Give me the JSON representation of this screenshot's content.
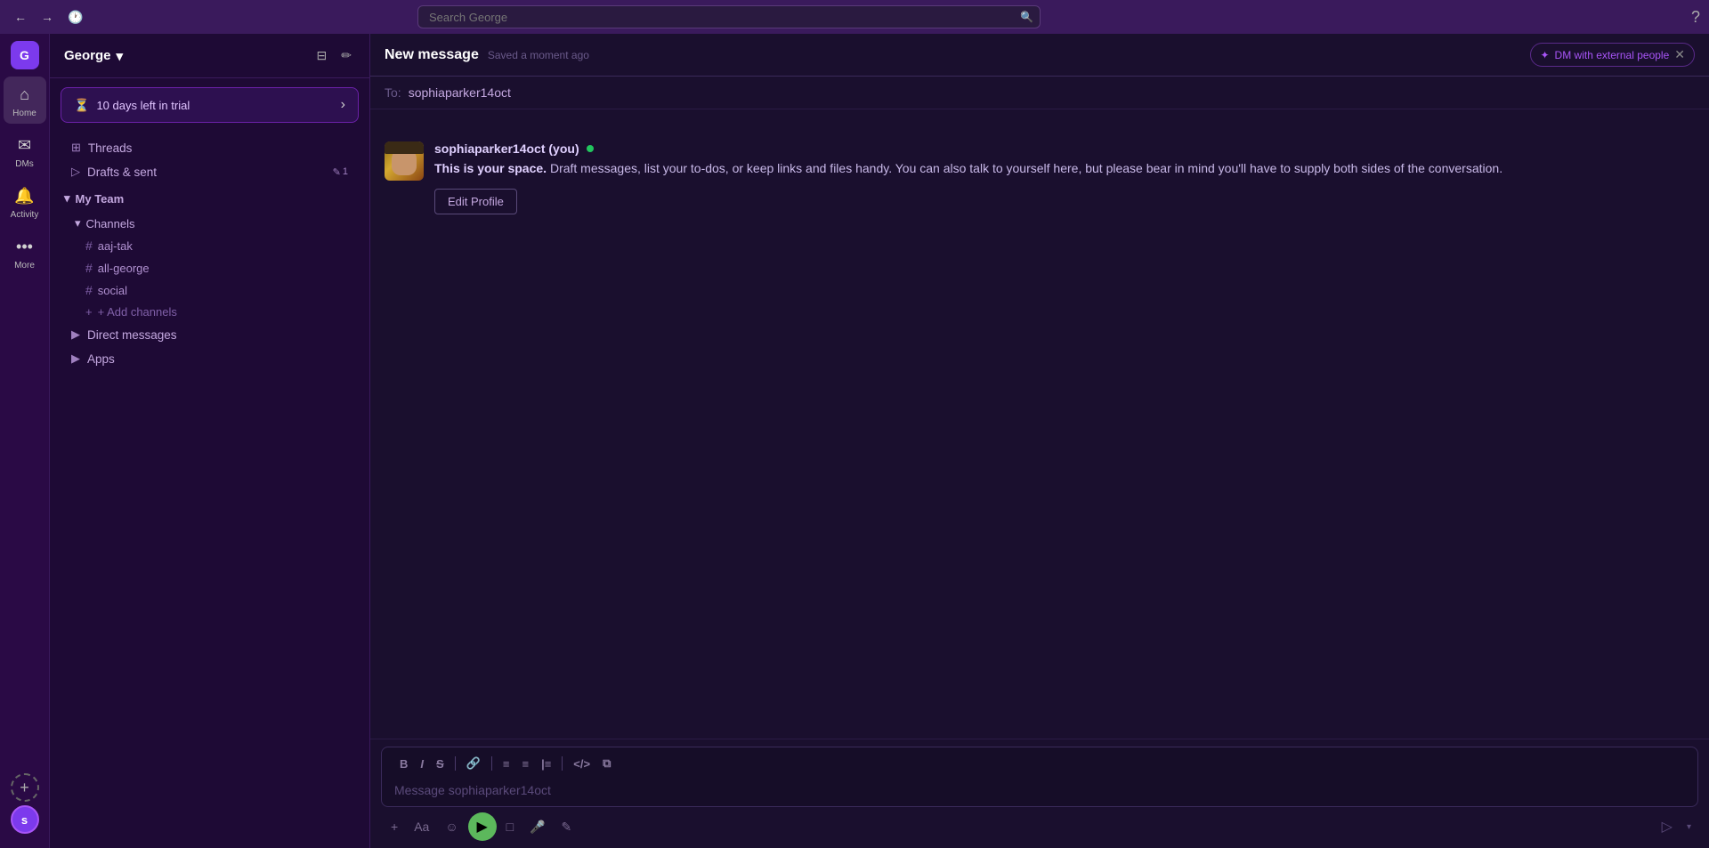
{
  "topbar": {
    "search_placeholder": "Search George",
    "search_icon": "🔍",
    "back_label": "←",
    "forward_label": "→",
    "history_label": "🕐",
    "question_icon": "?"
  },
  "icon_sidebar": {
    "workspace_initial": "G",
    "items": [
      {
        "label": "Home",
        "icon": "⌂",
        "name": "home"
      },
      {
        "label": "DMs",
        "icon": "✉",
        "name": "dms"
      },
      {
        "label": "Activity",
        "icon": "🔔",
        "name": "activity"
      },
      {
        "label": "More",
        "icon": "···",
        "name": "more"
      }
    ],
    "add_label": "+",
    "user_initial": "s"
  },
  "sidebar": {
    "workspace_name": "George",
    "chevron_icon": "▾",
    "filter_icon": "⊟",
    "compose_icon": "✏",
    "trial_banner": {
      "icon": "⏳",
      "text": "10 days left in trial",
      "chevron": "›"
    },
    "nav_items": [
      {
        "label": "Threads",
        "icon": "⊞",
        "name": "threads"
      },
      {
        "label": "Drafts & sent",
        "icon": "▷",
        "name": "drafts-sent",
        "badge_icon": "✎",
        "badge_count": "1"
      }
    ],
    "sections": [
      {
        "name": "My Team",
        "chevron": "▾",
        "subsections": [
          {
            "name": "Channels",
            "chevron": "▾",
            "channels": [
              {
                "name": "aaj-tak"
              },
              {
                "name": "all-george"
              },
              {
                "name": "social"
              }
            ],
            "add_label": "+ Add channels"
          }
        ],
        "direct_messages": {
          "label": "Direct messages",
          "chevron": "▶"
        },
        "apps": {
          "label": "Apps",
          "chevron": "▶"
        }
      }
    ]
  },
  "main": {
    "header": {
      "title": "New message",
      "saved_text": "Saved a moment ago",
      "dm_external_label": "DM with external people",
      "dm_external_icon": "✦",
      "close_icon": "✕"
    },
    "to_field": {
      "label": "To:",
      "value": "sophiaparker14oct"
    },
    "message": {
      "sender_name": "sophiaparker14oct (you)",
      "online_status": "online",
      "body_bold": "This is your space.",
      "body_text": " Draft messages, list your to-dos, or keep links and files handy. You can also talk to yourself here, but please bear in mind you'll have to supply both sides of the conversation.",
      "edit_profile_label": "Edit Profile"
    },
    "compose": {
      "placeholder": "Message sophiaparker14oct",
      "toolbar": [
        {
          "label": "B",
          "name": "bold"
        },
        {
          "label": "I",
          "name": "italic"
        },
        {
          "label": "S̶",
          "name": "strikethrough"
        },
        {
          "label": "🔗",
          "name": "link"
        },
        {
          "label": "≡",
          "name": "ordered-list"
        },
        {
          "label": "≡",
          "name": "unordered-list"
        },
        {
          "label": "|≡",
          "name": "blockquote"
        },
        {
          "label": "</>",
          "name": "code"
        },
        {
          "label": "⧉",
          "name": "code-block"
        }
      ],
      "bottom_toolbar": [
        {
          "label": "+",
          "name": "attach-plus"
        },
        {
          "label": "Aa",
          "name": "text-format"
        },
        {
          "label": "☺",
          "name": "emoji"
        },
        {
          "label": "▶",
          "name": "cursor-action",
          "active": true
        },
        {
          "label": "□",
          "name": "files"
        },
        {
          "label": "🎤",
          "name": "voice"
        },
        {
          "label": "✎",
          "name": "shortcut"
        }
      ],
      "send_icon": "▷",
      "send_dropdown_icon": "▾"
    }
  }
}
